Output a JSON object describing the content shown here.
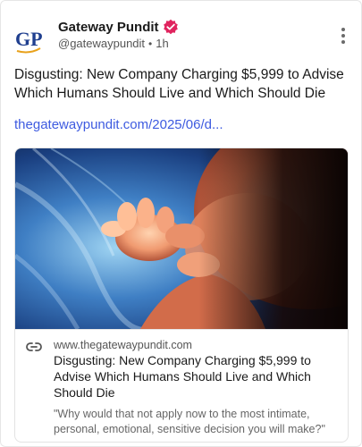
{
  "author": {
    "display_name": "Gateway Pundit",
    "handle": "@gatewaypundit",
    "separator": "•",
    "timestamp": "1h",
    "avatar_text": "GP",
    "avatar_color": "#1f3f8f",
    "verified_color": "#e0245e"
  },
  "post": {
    "text": "Disgusting: New Company Charging $5,999 to Advise Which Humans Should Live and Which Should Die",
    "link_text": "thegatewaypundit.com/2025/06/d..."
  },
  "card": {
    "domain": "www.thegatewaypundit.com",
    "title": "Disgusting: New Company Charging $5,999 to Advise Which Humans Should Live and Which Should Die",
    "description": "\"Why would that not apply now to the most intimate, personal, emotional, sensitive decision you will make?\"",
    "icon": "link-icon"
  },
  "colors": {
    "link": "#3e5be0",
    "text": "#1a1a1a",
    "muted": "#555555"
  }
}
